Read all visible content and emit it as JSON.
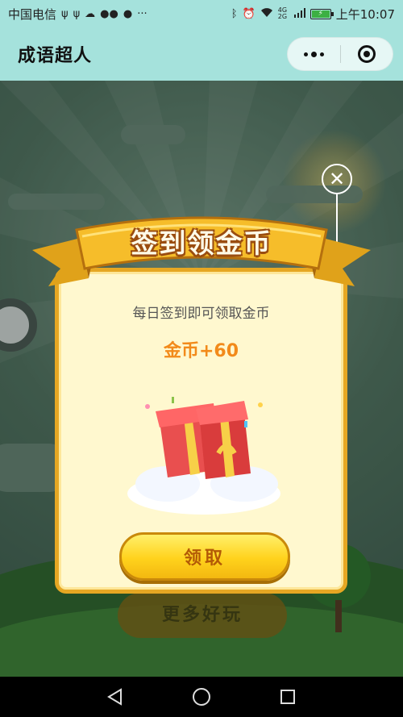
{
  "status_bar": {
    "carrier": "中国电信",
    "left_icons": [
      "usb-icon",
      "usb-icon",
      "cloud-message-icon",
      "wechat-icon",
      "chat-bubble-icon",
      "more-dots"
    ],
    "more": "···",
    "network": "4G 2G",
    "time": "上午10:07",
    "battery_color": "#3cb043"
  },
  "navbar": {
    "title": "成语超人",
    "bg_color": "#a5e2dc"
  },
  "background": {
    "under_button_label": "更多好玩"
  },
  "dialog": {
    "banner_title": "签到领金币",
    "subtitle": "每日签到即可领取金币",
    "reward": "金币+60",
    "claim_label": "领取",
    "close_symbol": "✕",
    "accent_color": "#e6a723",
    "reward_color": "#f28a1a"
  }
}
